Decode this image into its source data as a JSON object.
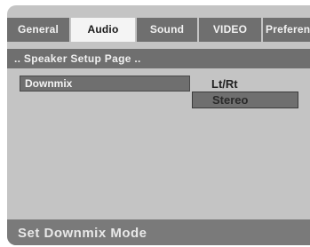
{
  "tabs": [
    {
      "label": "General",
      "active": false
    },
    {
      "label": "Audio",
      "active": true
    },
    {
      "label": "Sound",
      "active": false
    },
    {
      "label": "VIDEO",
      "active": false
    },
    {
      "label": "Preferen",
      "active": false
    }
  ],
  "page_header": ".. Speaker Setup Page ..",
  "menu": {
    "item_label": "Downmix"
  },
  "options": [
    {
      "label": "Lt/Rt",
      "selected": false
    },
    {
      "label": "Stereo",
      "selected": true
    }
  ],
  "status": "Set Downmix Mode",
  "colors": {
    "panel": "#c4c4c4",
    "bar": "#6f6f6f",
    "active_tab": "#f4f4f4"
  }
}
